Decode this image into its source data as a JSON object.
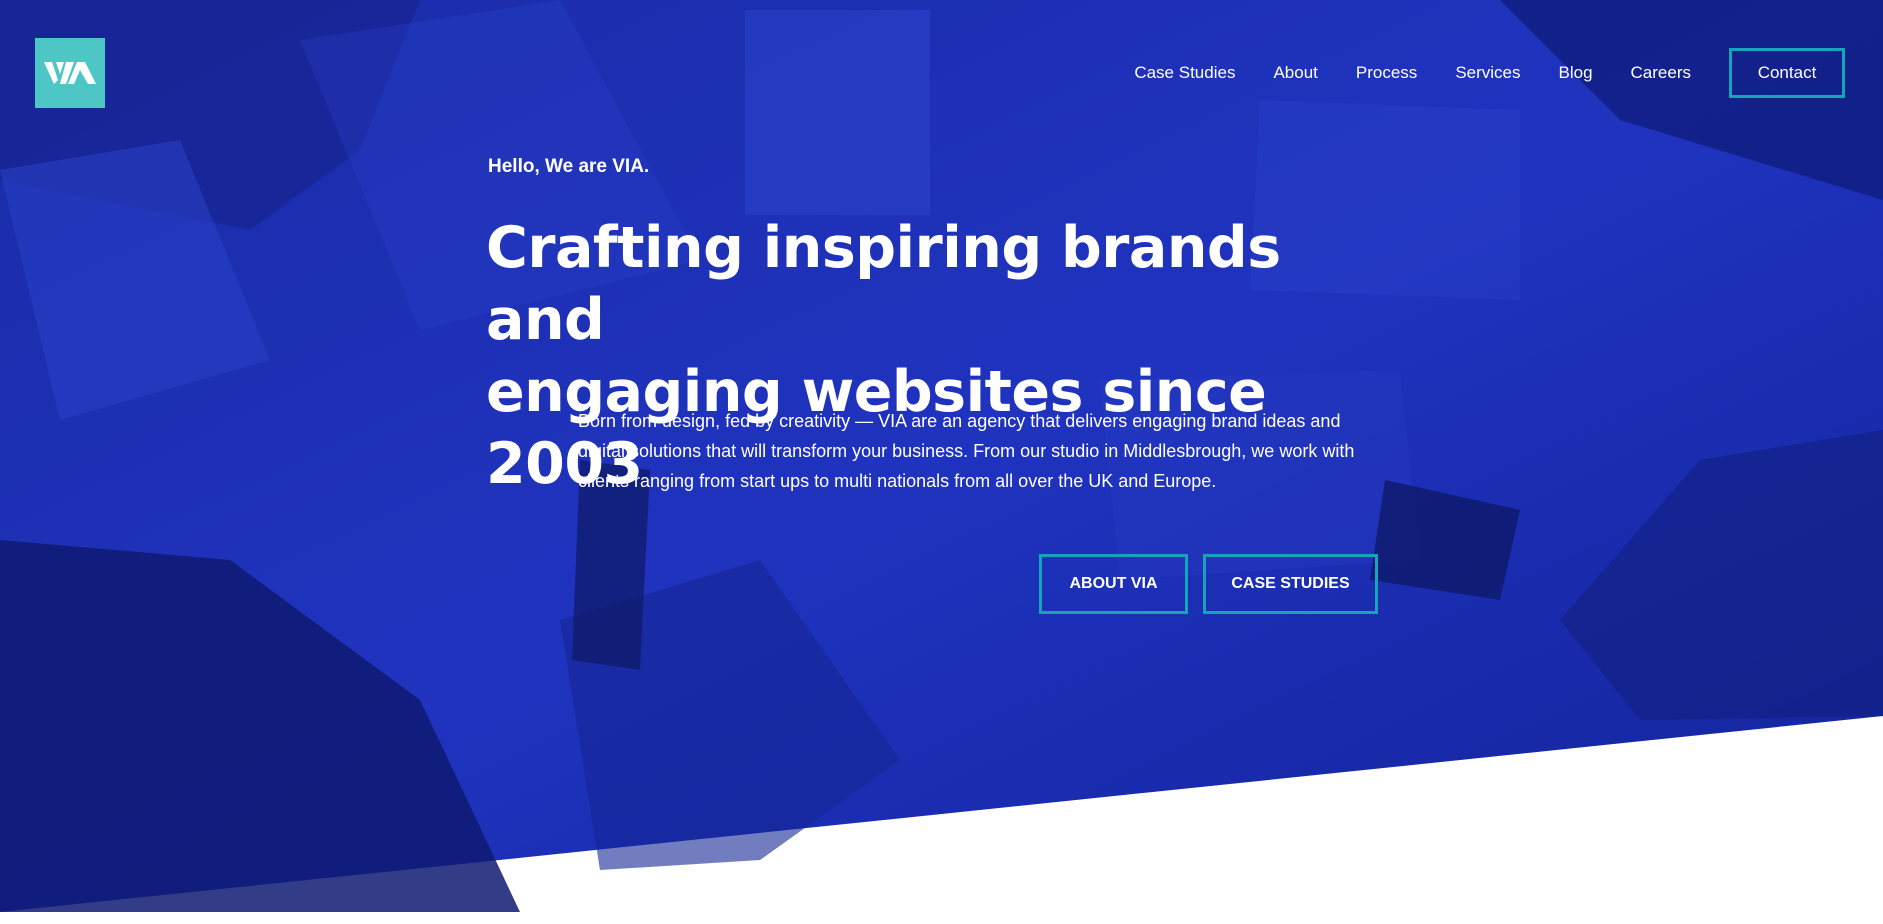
{
  "brand": {
    "logo_text": "VIA",
    "accent_color": "#4fc6c6",
    "button_border_color": "#17a3b8",
    "hero_overlay_color": "#1c2fb8"
  },
  "nav": {
    "items": [
      {
        "label": "Case Studies"
      },
      {
        "label": "About"
      },
      {
        "label": "Process"
      },
      {
        "label": "Services"
      },
      {
        "label": "Blog"
      },
      {
        "label": "Careers"
      }
    ],
    "contact_label": "Contact"
  },
  "hero": {
    "eyebrow": "Hello, We are VIA.",
    "headline_line1": "Crafting inspiring brands and",
    "headline_line2": "engaging websites since 2003",
    "intro": "Born from design, fed by creativity — VIA are an agency that delivers engaging brand ideas and digital solutions that will transform your business. From our studio in Middlesbrough, we work with clients ranging from start ups to multi nationals from all over the UK and Europe.",
    "buttons": {
      "about_label": "ABOUT VIA",
      "cases_label": "CASE STUDIES"
    }
  }
}
